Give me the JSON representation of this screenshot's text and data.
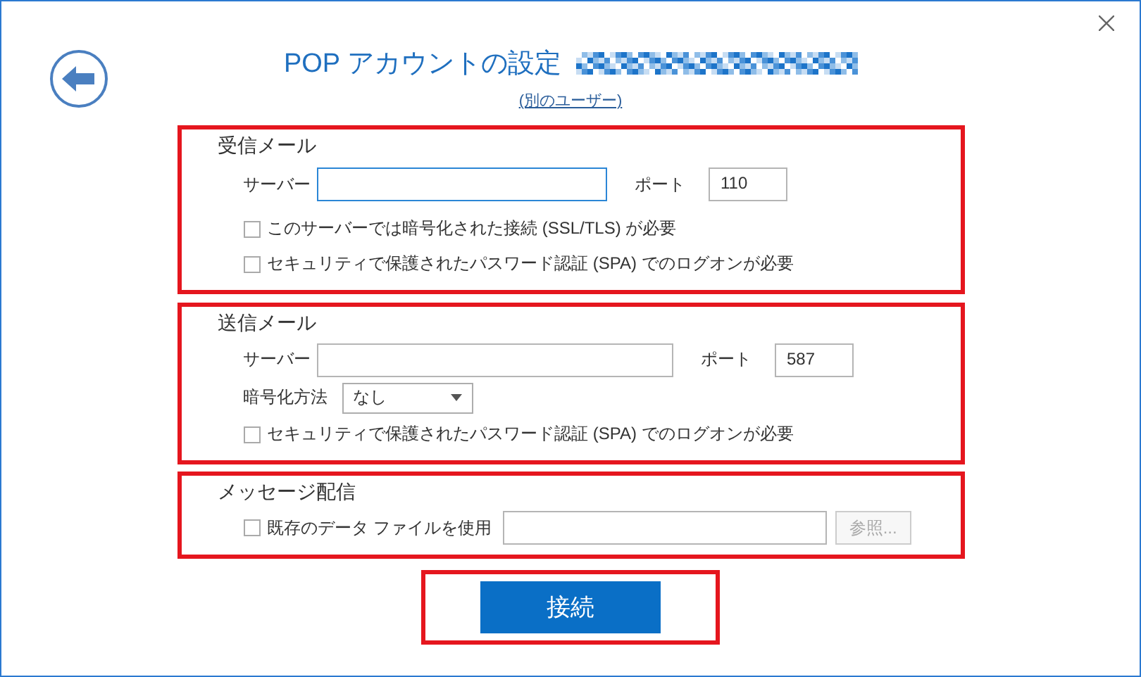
{
  "dialog": {
    "title": "POP アカウントの設定",
    "alt_user_link": "(別のユーザー)"
  },
  "incoming": {
    "heading": "受信メール",
    "server_label": "サーバー",
    "port_label": "ポート",
    "port_value": "110",
    "server_focused": true,
    "options": [
      {
        "label": "このサーバーでは暗号化された接続 (SSL/TLS) が必要",
        "checked": false
      },
      {
        "label": "セキュリティで保護されたパスワード認証 (SPA) でのログオンが必要",
        "checked": false
      }
    ]
  },
  "outgoing": {
    "heading": "送信メール",
    "server_label": "サーバー",
    "port_label": "ポート",
    "port_value": "587",
    "encryption_label": "暗号化方法",
    "encryption_value": "なし",
    "options": [
      {
        "label": "セキュリティで保護されたパスワード認証 (SPA) でのログオンが必要",
        "checked": false
      }
    ]
  },
  "delivery": {
    "heading": "メッセージ配信",
    "option": {
      "label": "既存のデータ ファイルを使用",
      "checked": false
    },
    "browse_button": {
      "label": "参照...",
      "disabled": true
    }
  },
  "connect_button": {
    "label": "接続"
  }
}
